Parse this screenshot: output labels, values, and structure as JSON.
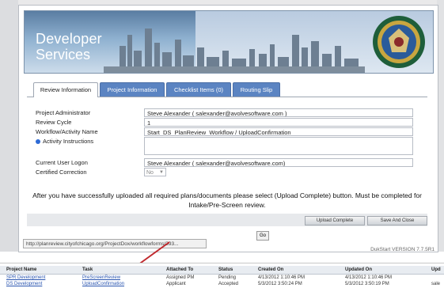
{
  "banner": {
    "brand_line1": "Developer",
    "brand_line2": "Services",
    "seal_icon": "city-seal-icon"
  },
  "tabs": [
    {
      "label": "Review Information",
      "active": true
    },
    {
      "label": "Project Information",
      "active": false
    },
    {
      "label": "Checklist Items (0)",
      "active": false
    },
    {
      "label": "Routing Slip",
      "active": false
    }
  ],
  "form": {
    "project_admin_label": "Project Administrator",
    "project_admin_value": "Steve Alexander  ( salexander@avolvesoftware.com )",
    "review_cycle_label": "Review Cycle",
    "review_cycle_value": "1",
    "workflow_label": "Workflow/Activity Name",
    "workflow_value": "Start_DS_PlanReview_Workflow / UploadConfirmation",
    "instructions_label": "Activity Instructions",
    "current_user_label": "Current User Logon",
    "current_user_value": "Steve Alexander  ( salexander@avolvesoftware.com)",
    "certified_label": "Certified Correction",
    "certified_value": "No"
  },
  "notice": "After you have successfully uploaded all required plans/documents please select (Upload Complete) button. Must be completed for Intake/Pre-Screen review.",
  "buttons": {
    "upload_complete": "Upload Complete",
    "save_close": "Save And Close",
    "go": "Go"
  },
  "statusbar": {
    "url": "http://planreview.cityofchicago.org/ProjectDox/workflowforms/393..."
  },
  "version": "DukStart VERSION 7.7.5R1",
  "task_table": {
    "headers": [
      "Project Name",
      "Task",
      "Attached To",
      "Status",
      "Created On",
      "Updated On",
      "Upd"
    ],
    "rows": [
      [
        "SPR Development",
        "PreScreenReview",
        "Assigned PM",
        "Pending",
        "4/13/2012 1:10:46 PM",
        "4/13/2012 1:10:46 PM",
        ""
      ],
      [
        "DS Development",
        "UploadConfirmation",
        "Applicant",
        "Accepted",
        "5/3/2012 3:50:24 PM",
        "5/3/2012 3:50:19 PM",
        "sale"
      ]
    ]
  }
}
